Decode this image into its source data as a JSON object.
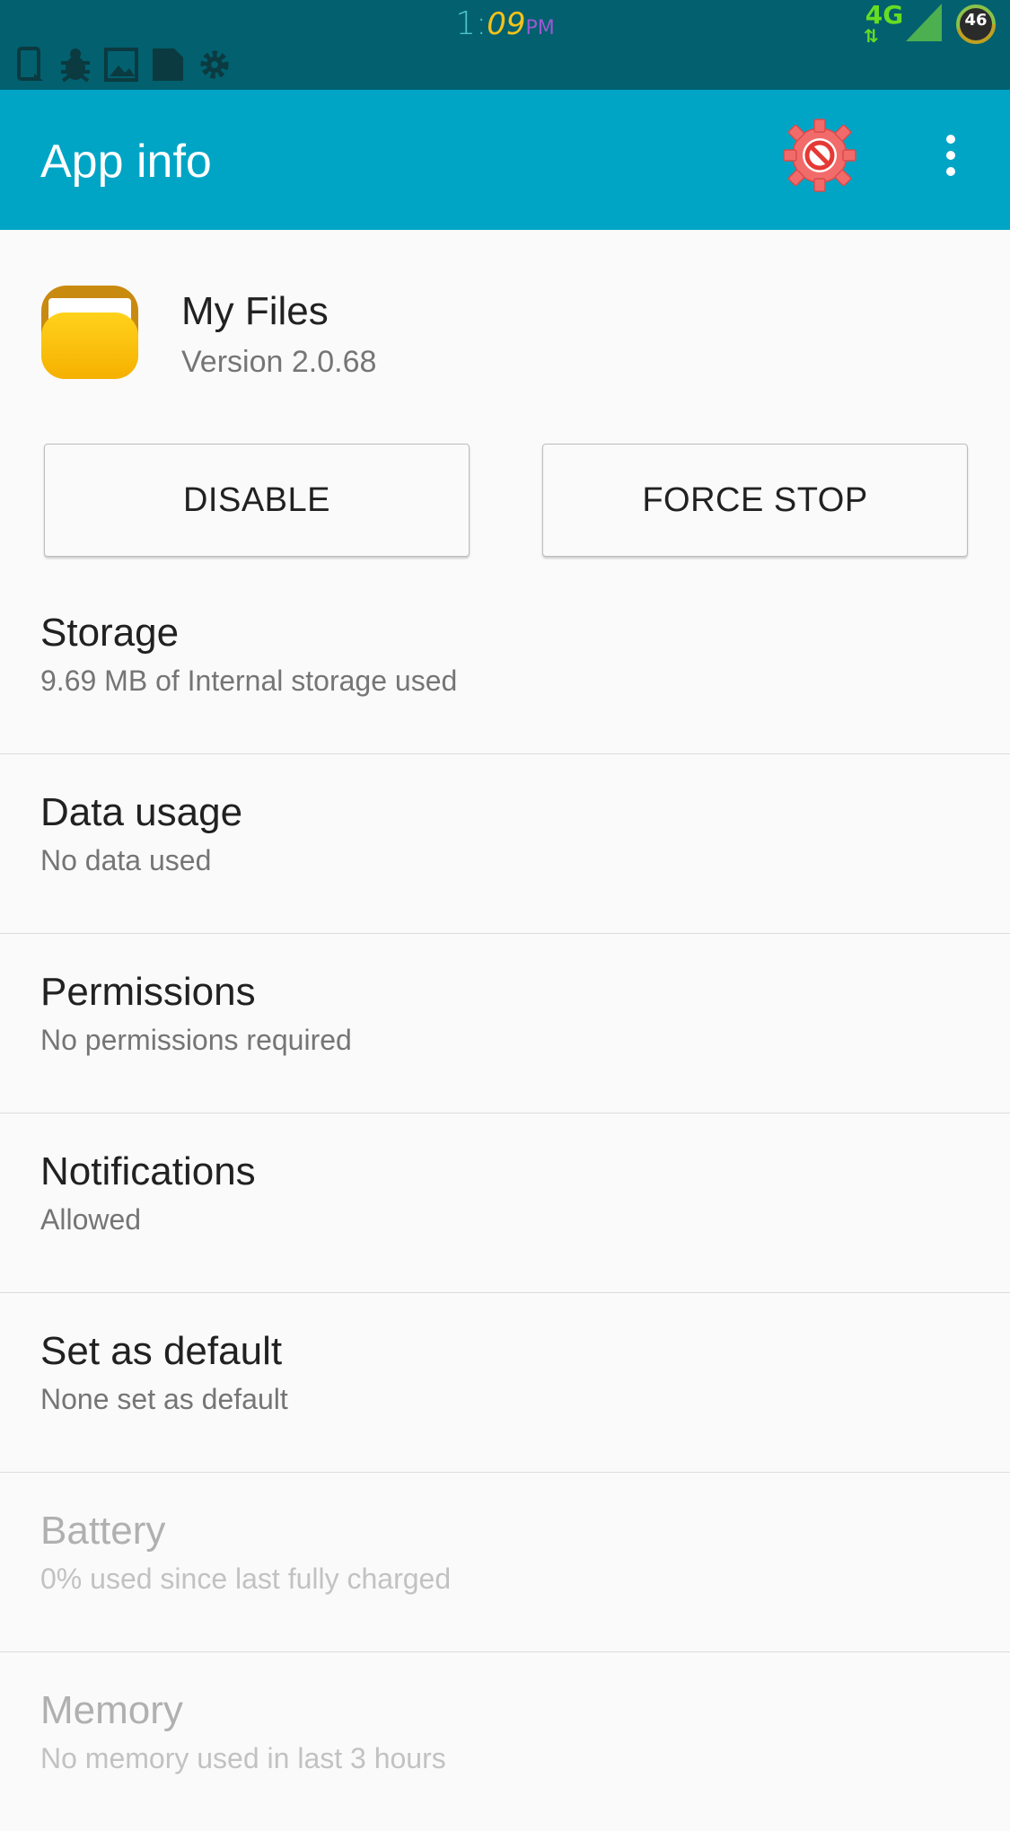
{
  "status_bar": {
    "time_hour": "1:",
    "time_minutes": "09",
    "time_ampm": "PM",
    "network_type": "4G",
    "network_arrows": "⇅",
    "battery_level": "46",
    "notification_icons": [
      "device-sync-icon",
      "bug-icon",
      "image-icon",
      "file-icon",
      "gear-icon"
    ]
  },
  "app_bar": {
    "title": "App info",
    "color": "#00a5c6"
  },
  "app": {
    "name": "My Files",
    "version": "Version 2.0.68"
  },
  "buttons": {
    "disable_label": "DISABLE",
    "force_stop_label": "FORCE STOP"
  },
  "list": [
    {
      "title": "Storage",
      "subtitle": "9.69 MB of Internal storage used",
      "enabled": true
    },
    {
      "title": "Data usage",
      "subtitle": "No data used",
      "enabled": true
    },
    {
      "title": "Permissions",
      "subtitle": "No permissions required",
      "enabled": true
    },
    {
      "title": "Notifications",
      "subtitle": "Allowed",
      "enabled": true
    },
    {
      "title": "Set as default",
      "subtitle": "None set as default",
      "enabled": true
    },
    {
      "title": "Battery",
      "subtitle": "0% used since last fully charged",
      "enabled": false
    },
    {
      "title": "Memory",
      "subtitle": "No memory used in last 3 hours",
      "enabled": false
    }
  ]
}
